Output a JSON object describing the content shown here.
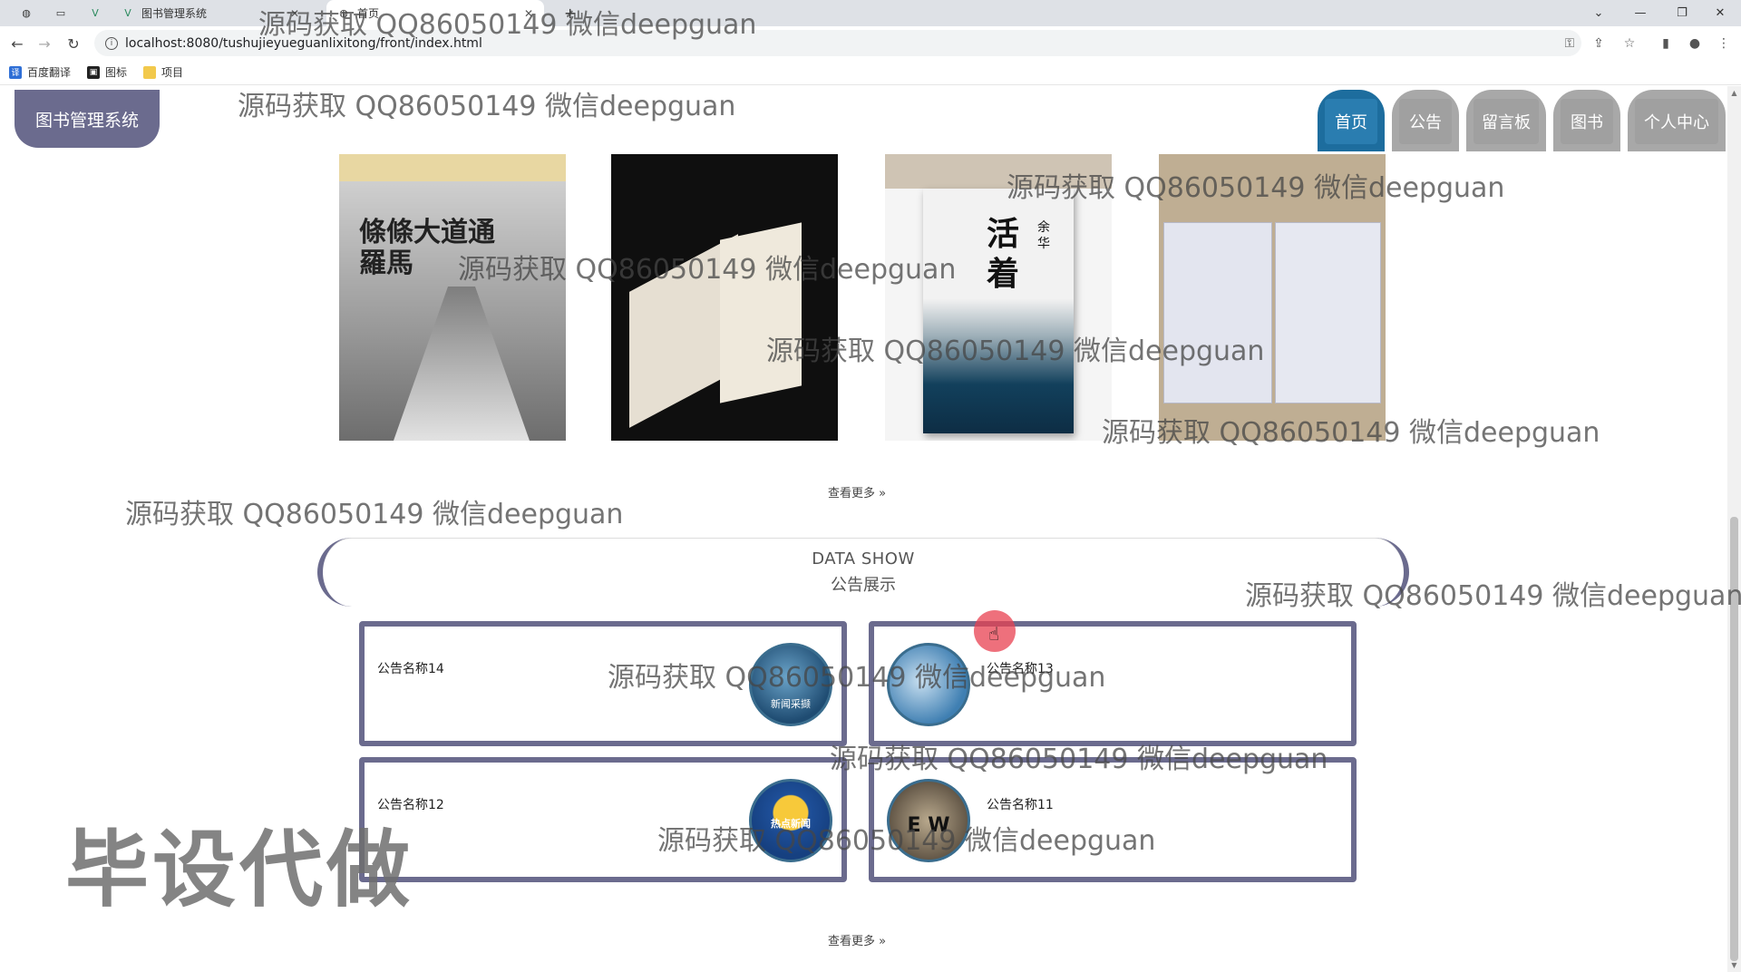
{
  "browser": {
    "tabs": [
      {
        "label": "",
        "active": false
      },
      {
        "label": "图书管理系统",
        "active": false
      },
      {
        "label": "首页",
        "active": true
      }
    ],
    "url": "localhost:8080/tushujieyueguanlixitong/front/index.html",
    "bookmarks": [
      "百度翻译",
      "图标",
      "项目"
    ]
  },
  "header": {
    "logo": "图书管理系统",
    "nav": [
      {
        "label": "首页",
        "active": true
      },
      {
        "label": "公告",
        "active": false
      },
      {
        "label": "留言板",
        "active": false
      },
      {
        "label": "图书",
        "active": false
      },
      {
        "label": "个人中心",
        "active": false
      }
    ]
  },
  "books": {
    "covers": [
      {
        "title": "條條大道通羅馬"
      },
      {
        "title": ""
      },
      {
        "title": "活着",
        "author": "余华"
      },
      {
        "title": ""
      }
    ],
    "more": "查看更多 »"
  },
  "data_show": {
    "en": "DATA SHOW",
    "zh": "公告展示"
  },
  "notices": [
    {
      "title": "公告名称14",
      "thumb_label": "新闻采撷"
    },
    {
      "title": "公告名称13",
      "thumb_label": ""
    },
    {
      "title": "公告名称12",
      "thumb_label": "热点新闻"
    },
    {
      "title": "公告名称11",
      "thumb_label": "E W"
    }
  ],
  "notices_more": "查看更多 »",
  "watermark": "源码获取 QQ86050149 微信deepguan",
  "big_watermark": "毕设代做",
  "colors": {
    "accent": "#6b6b8e",
    "nav_active": "#1d6d9e",
    "nav_inactive": "#a8a8a8"
  }
}
